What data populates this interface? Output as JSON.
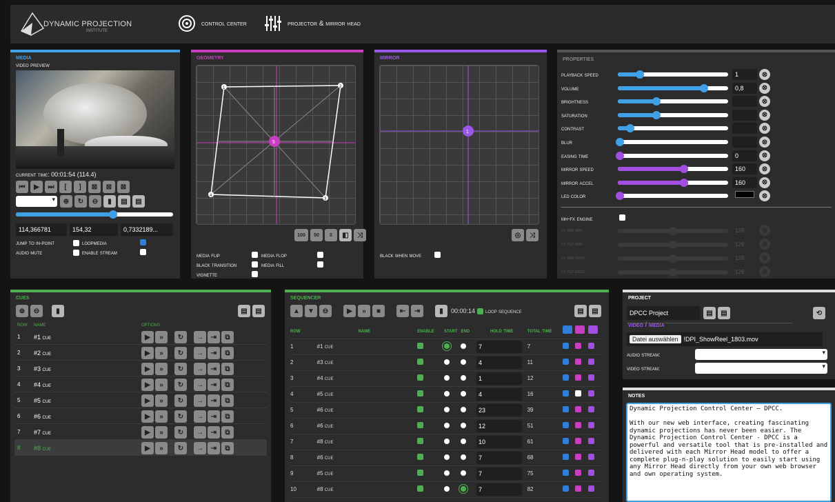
{
  "header": {
    "logo_text": "DYNAMIC PROJECTION",
    "logo_sub": "INSTITUTE",
    "nav_control": "Control Center",
    "nav_projector": "Projector & Mirror Head"
  },
  "media": {
    "title": "Media",
    "video_preview": "Video Preview",
    "current_time": "Current Time: 00:01:54 (114.4)",
    "values": [
      "114,366781",
      "154,32",
      "0,7332189..."
    ],
    "jump_in": "Jump to IN-Point",
    "loopmedia": "Loopmedia",
    "audio_mute": "Audio Mute",
    "enable_stream": "Enable Stream",
    "progress": 0.62
  },
  "geometry": {
    "title": "Geometry",
    "btns": [
      "100",
      "50",
      "0"
    ],
    "media_flip": "Media Flip",
    "media_flop": "Media Flop",
    "black_transition": "Black transition",
    "media_fill": "Media Fill",
    "vignette": "Vignette",
    "points": [
      "1",
      "2",
      "3",
      "4",
      "5"
    ]
  },
  "mirror": {
    "title": "Mirror",
    "black_when_move": "Black when move",
    "point": "1"
  },
  "properties": {
    "title": "Properties",
    "rows": [
      {
        "label": "Playback Speed",
        "value": "1",
        "pos": 0.2,
        "color": "#3fa0e6"
      },
      {
        "label": "Volume",
        "value": "0,8",
        "pos": 0.78,
        "color": "#3fa0e6"
      },
      {
        "label": "Brightness",
        "value": "",
        "pos": 0.35,
        "color": "#3fa0e6"
      },
      {
        "label": "Saturation",
        "value": "",
        "pos": 0.35,
        "color": "#3fa0e6"
      },
      {
        "label": "Contrast",
        "value": "",
        "pos": 0.11,
        "color": "#3fa0e6"
      },
      {
        "label": "Blur",
        "value": "",
        "pos": 0.02,
        "color": "#3fa0e6"
      },
      {
        "label": "Easing time",
        "value": "0",
        "pos": 0.02,
        "color": "#a24ee0"
      },
      {
        "label": "Mirror Speed",
        "value": "160",
        "pos": 0.6,
        "color": "#a24ee0"
      },
      {
        "label": "Mirror Accel",
        "value": "160",
        "pos": 0.6,
        "color": "#a24ee0"
      },
      {
        "label": "LED Color",
        "value": "",
        "pos": 0.02,
        "color": "#a24ee0"
      }
    ],
    "mhfx": "MH-FX Engine",
    "fx": [
      {
        "label": "FX Pan Amp.",
        "value": "128"
      },
      {
        "label": "FX Tilt Amp.",
        "value": "128"
      },
      {
        "label": "FX Pan Freq.",
        "value": "128"
      },
      {
        "label": "FX Tilt Freq.",
        "value": "128"
      }
    ]
  },
  "cues": {
    "title": "Cues",
    "col_row": "Row",
    "col_name": "Name",
    "col_options": "Options",
    "rows": [
      {
        "n": "1",
        "name": "#1 Cue"
      },
      {
        "n": "2",
        "name": "#2 Cue"
      },
      {
        "n": "3",
        "name": "#3 Cue"
      },
      {
        "n": "4",
        "name": "#4 Cue"
      },
      {
        "n": "5",
        "name": "#5 Cue"
      },
      {
        "n": "6",
        "name": "#6 Cue"
      },
      {
        "n": "7",
        "name": "#7 Cue"
      },
      {
        "n": "8",
        "name": "#8 Cue"
      }
    ]
  },
  "sequencer": {
    "title": "Sequencer",
    "time": "00:00:14",
    "loop": "Loop Sequence",
    "headers": [
      "Row",
      "Name",
      "Enable",
      "Start",
      "End",
      "Hold Time",
      "Total Time"
    ],
    "rows": [
      {
        "n": "1",
        "name": "#1 Cue",
        "hold": "7",
        "total": "7"
      },
      {
        "n": "2",
        "name": "#3 Cue",
        "hold": "4",
        "total": "11"
      },
      {
        "n": "3",
        "name": "#4 Cue",
        "hold": "1",
        "total": "12"
      },
      {
        "n": "4",
        "name": "#5 Cue",
        "hold": "4",
        "total": "16"
      },
      {
        "n": "5",
        "name": "#6 Cue",
        "hold": "23",
        "total": "39"
      },
      {
        "n": "6",
        "name": "#6 Cue",
        "hold": "12",
        "total": "51"
      },
      {
        "n": "7",
        "name": "#8 Cue",
        "hold": "10",
        "total": "61"
      },
      {
        "n": "8",
        "name": "#6 Cue",
        "hold": "7",
        "total": "68"
      },
      {
        "n": "9",
        "name": "#5 Cue",
        "hold": "7",
        "total": "75"
      },
      {
        "n": "10",
        "name": "#8 Cue",
        "hold": "7",
        "total": "82"
      }
    ]
  },
  "project": {
    "title": "Project",
    "name": "DPCC Project",
    "video_media": "Video / Media",
    "file_btn": "Datei auswählen",
    "file_name": "!DPI_ShowReel_1803.mov",
    "audio_stream": "Audio stream:",
    "video_stream": "Video stream:"
  },
  "notes": {
    "title": "Notes",
    "text": "Dynamic Projection Control Center – DPCC.\n\nWith our new web interface, creating fascinating dynamic projections has never been easier. The Dynamic Projection Control Center - DPCC is a powerful and versatile tool that is pre-installed and delivered with each Mirror Head model to offer a complete plug-n-play solution to easily start using any Mirror Head directly from your own web browser and own operating system."
  }
}
